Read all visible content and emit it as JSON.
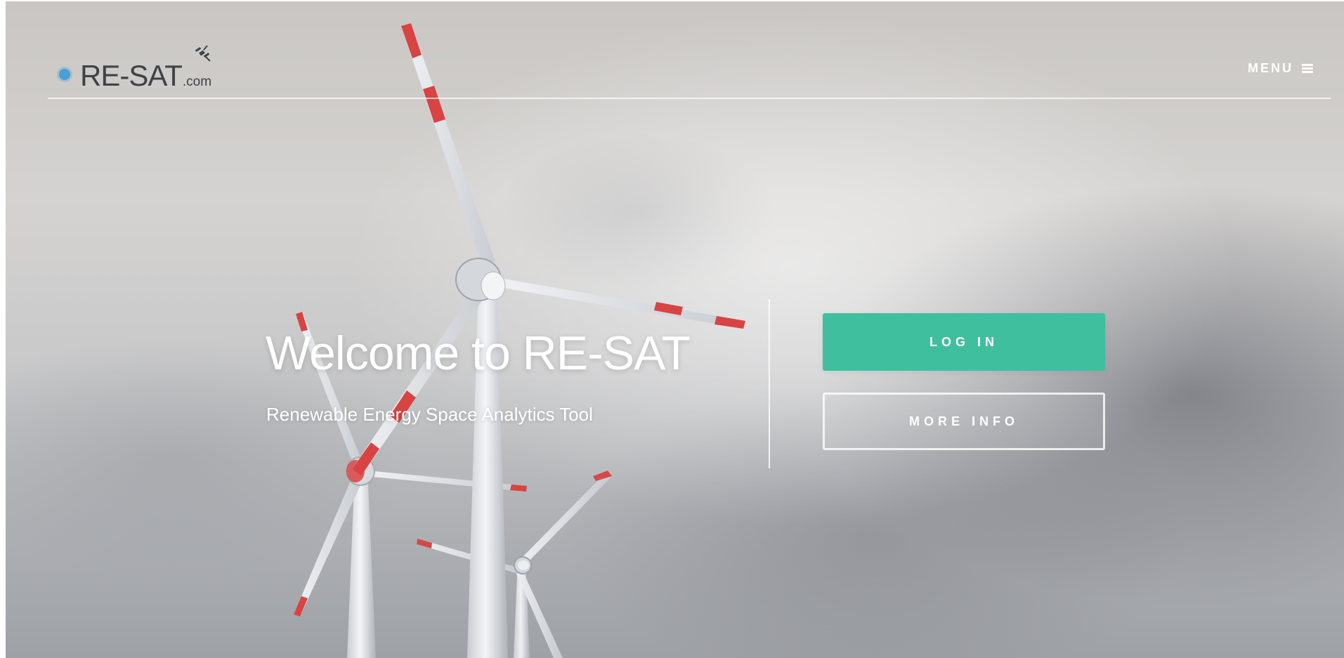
{
  "header": {
    "logo": {
      "main_text": "RE-SAT",
      "domain_text": ".com"
    },
    "menu_label": "MENU"
  },
  "hero": {
    "title": "Welcome to RE-SAT",
    "subtitle": "Renewable Energy Space Analytics Tool"
  },
  "actions": {
    "login_label": "LOG IN",
    "more_info_label": "MORE INFO"
  },
  "colors": {
    "accent": "#3fbf9d",
    "logo_blue": "#4a9fd7",
    "logo_text": "#3e4347",
    "turbine_red": "#d84343",
    "white": "#ffffff"
  },
  "icons": {
    "logo_mark": "blue-dot-icon",
    "satellite": "satellite-icon",
    "menu": "hamburger-menu-icon"
  }
}
